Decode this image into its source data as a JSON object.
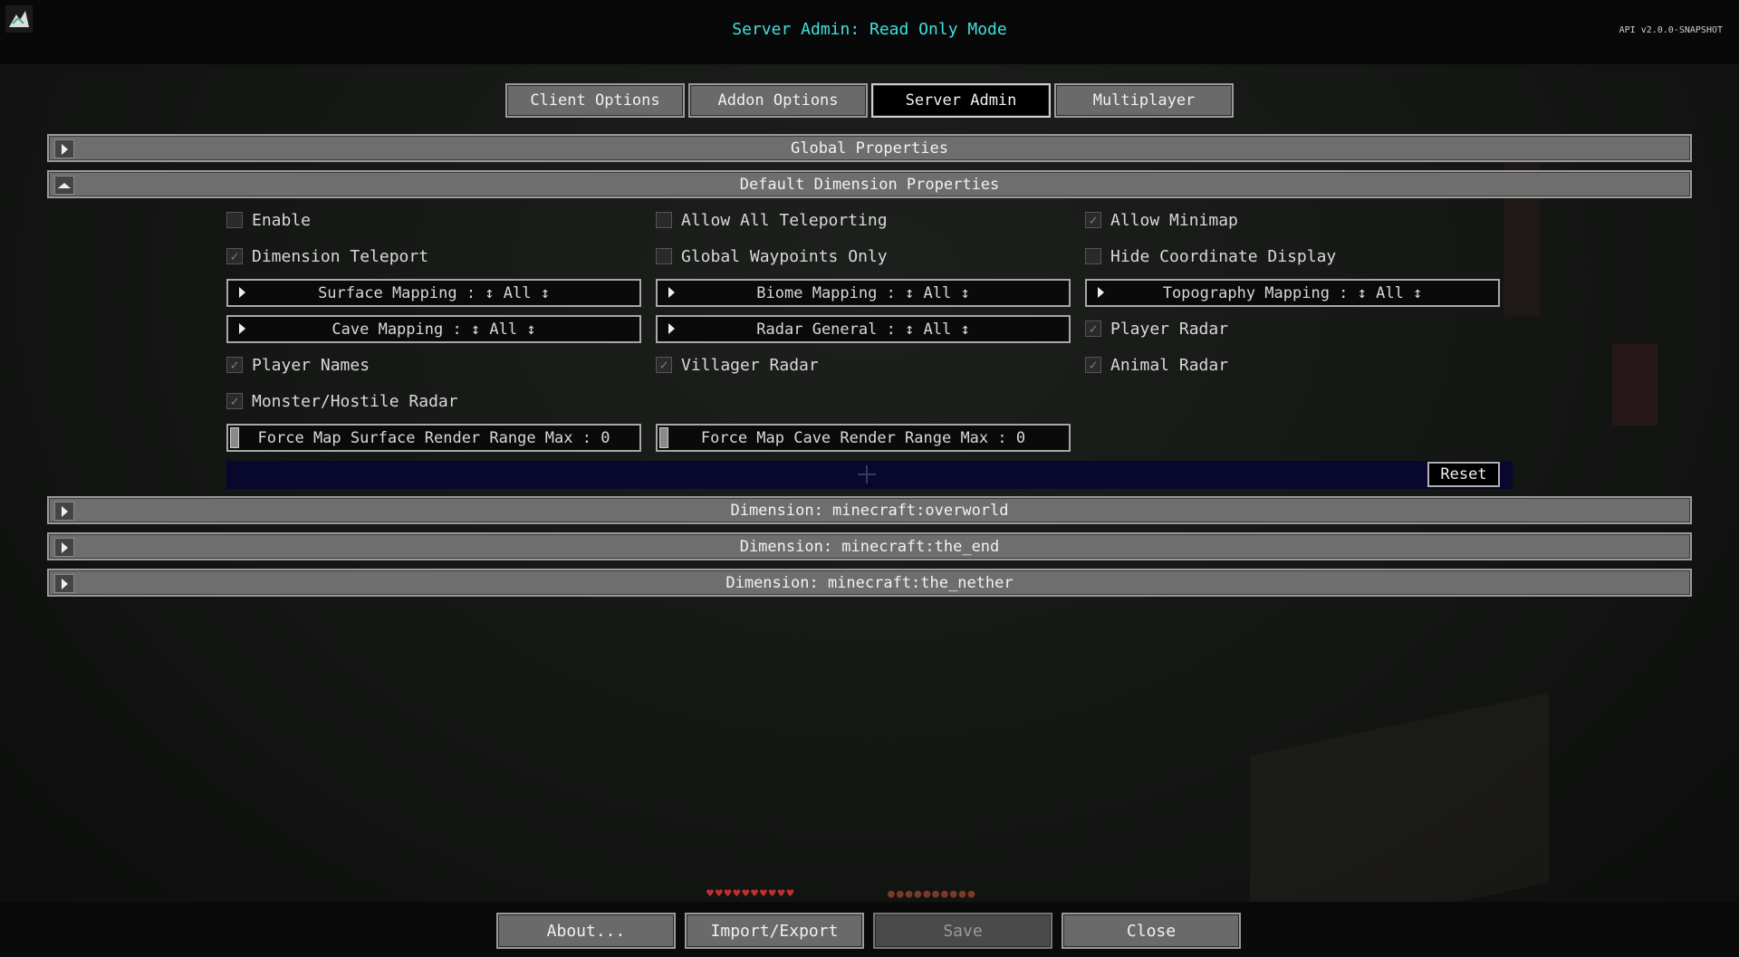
{
  "header": {
    "title": "Server Admin: Read Only Mode",
    "version": "API v2.0.0-SNAPSHOT",
    "logo_icon": "journeymap-logo-icon",
    "title_color": "#3fe0e0"
  },
  "tabs": [
    {
      "label": "Client Options",
      "active": false
    },
    {
      "label": "Addon Options",
      "active": false
    },
    {
      "label": "Server Admin",
      "active": true
    },
    {
      "label": "Multiplayer",
      "active": false
    }
  ],
  "sections": {
    "global": "Global Properties",
    "default_dimension": "Default Dimension Properties",
    "overworld": "Dimension: minecraft:overworld",
    "the_end": "Dimension: minecraft:the_end",
    "the_nether": "Dimension: minecraft:the_nether"
  },
  "options": {
    "enable": {
      "label": "Enable",
      "checked": false
    },
    "allow_all_teleporting": {
      "label": "Allow All Teleporting",
      "checked": false
    },
    "allow_minimap": {
      "label": "Allow Minimap",
      "checked": true
    },
    "dimension_teleport": {
      "label": "Dimension Teleport",
      "checked": true
    },
    "global_waypoints_only": {
      "label": "Global Waypoints Only",
      "checked": false
    },
    "hide_coordinate_display": {
      "label": "Hide Coordinate Display",
      "checked": false
    },
    "player_radar": {
      "label": "Player Radar",
      "checked": true
    },
    "player_names": {
      "label": "Player Names",
      "checked": true
    },
    "villager_radar": {
      "label": "Villager Radar",
      "checked": true
    },
    "animal_radar": {
      "label": "Animal Radar",
      "checked": true
    },
    "monster_radar": {
      "label": "Monster/Hostile Radar",
      "checked": true
    }
  },
  "dropdowns": {
    "surface_mapping": "Surface Mapping : ↕ All ↕",
    "biome_mapping": "Biome Mapping : ↕ All ↕",
    "topography_mapping": "Topography Mapping : ↕ All ↕",
    "cave_mapping": "Cave Mapping : ↕ All ↕",
    "radar_general": "Radar General : ↕ All ↕"
  },
  "sliders": {
    "surface_range": {
      "label": "Force Map Surface Render Range Max : 0",
      "value": 0
    },
    "cave_range": {
      "label": "Force Map Cave Render Range Max : 0",
      "value": 0
    }
  },
  "reset_label": "Reset",
  "bottom": {
    "about": "About...",
    "import_export": "Import/Export",
    "save": "Save",
    "close": "Close"
  }
}
